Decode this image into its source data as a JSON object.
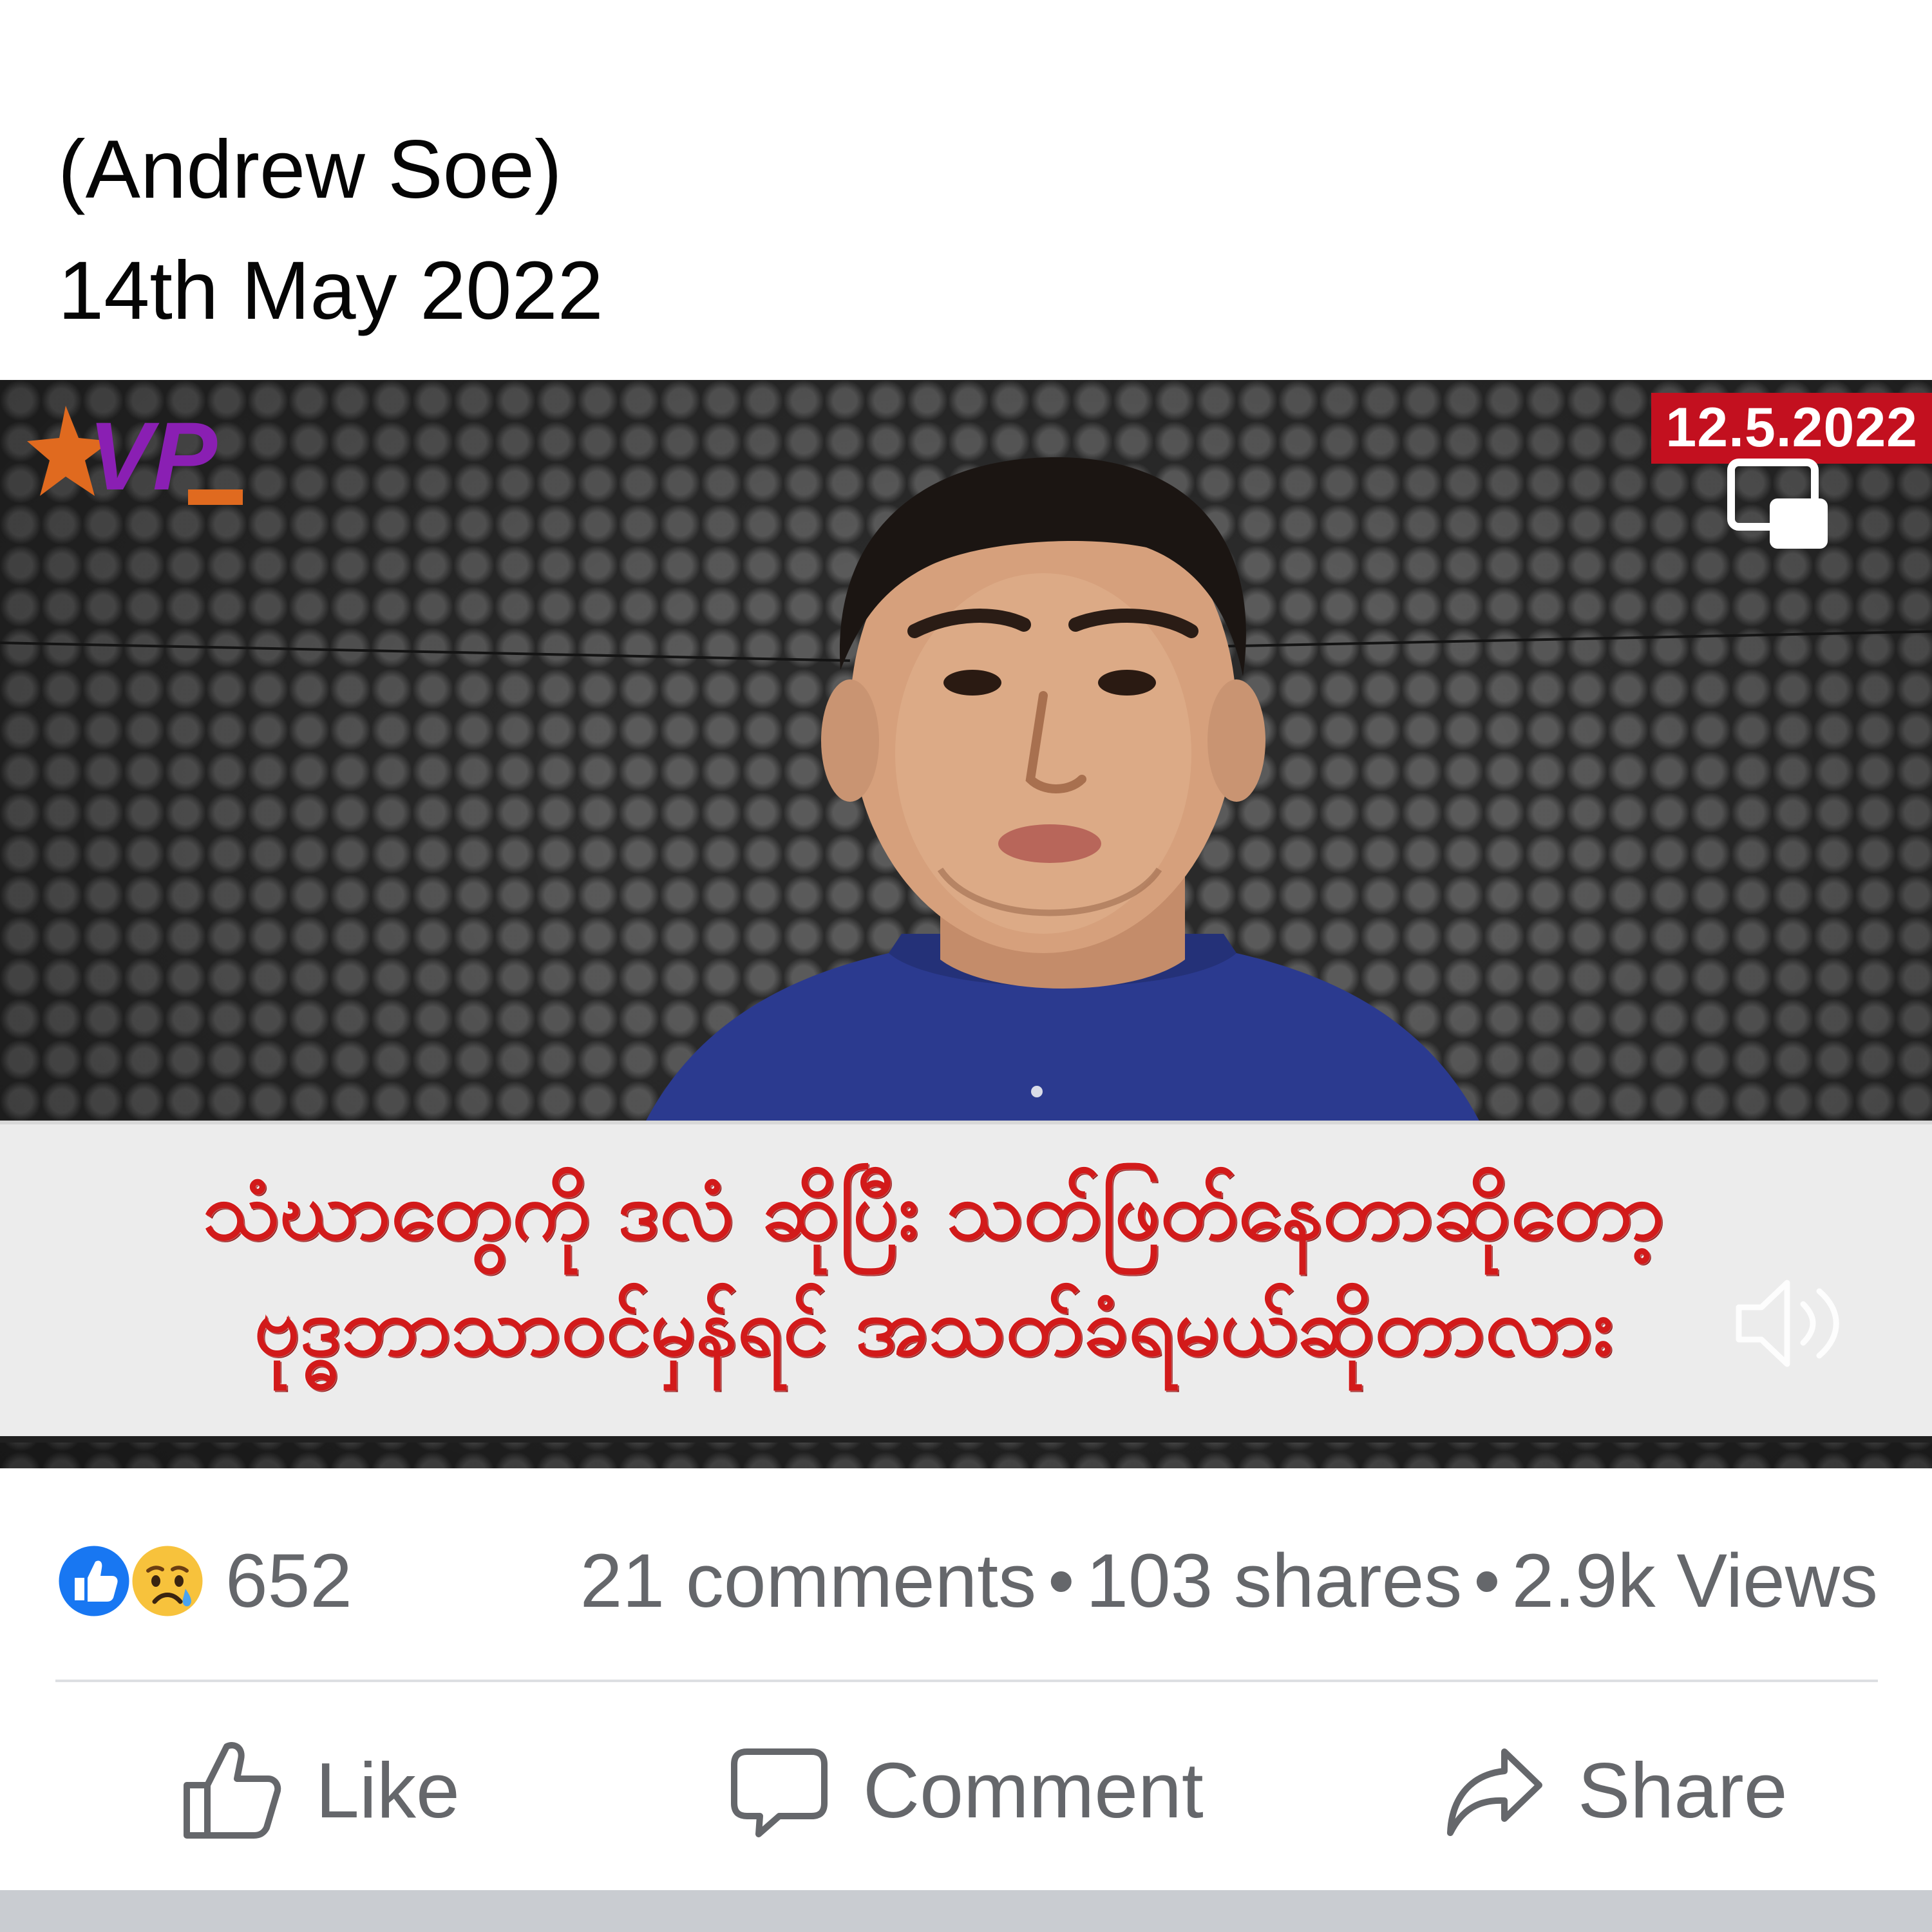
{
  "post": {
    "caption_line1": "(Andrew Soe)",
    "caption_line2": "14th May 2022"
  },
  "video": {
    "logo_text": "VP",
    "date_badge": "12.5.2022",
    "subtitle_line1": "သံဃာတွေကို ဒလံ ဆိုပြီး သတ်ဖြတ်နေတာဆိုတော့",
    "subtitle_line2": "ဗုဒ္ဓဘာသာဝင်မှန်ရင် အသတ်ခံရမယ်ဆိုတာလား",
    "pip_icon": "picture-in-picture-icon",
    "volume_icon": "volume-icon"
  },
  "stats": {
    "reaction_count": "652",
    "comments": "21 comments",
    "shares": "103 shares",
    "views": "2.9k Views",
    "separator": "•"
  },
  "actions": {
    "like_label": "Like",
    "comment_label": "Comment",
    "share_label": "Share"
  },
  "colors": {
    "text_primary": "#050505",
    "text_secondary": "#65676b",
    "like_blue": "#1877f2",
    "badge_red": "#c3101f",
    "subtitle_red": "#d21a1a",
    "divider": "#dddfe2"
  }
}
